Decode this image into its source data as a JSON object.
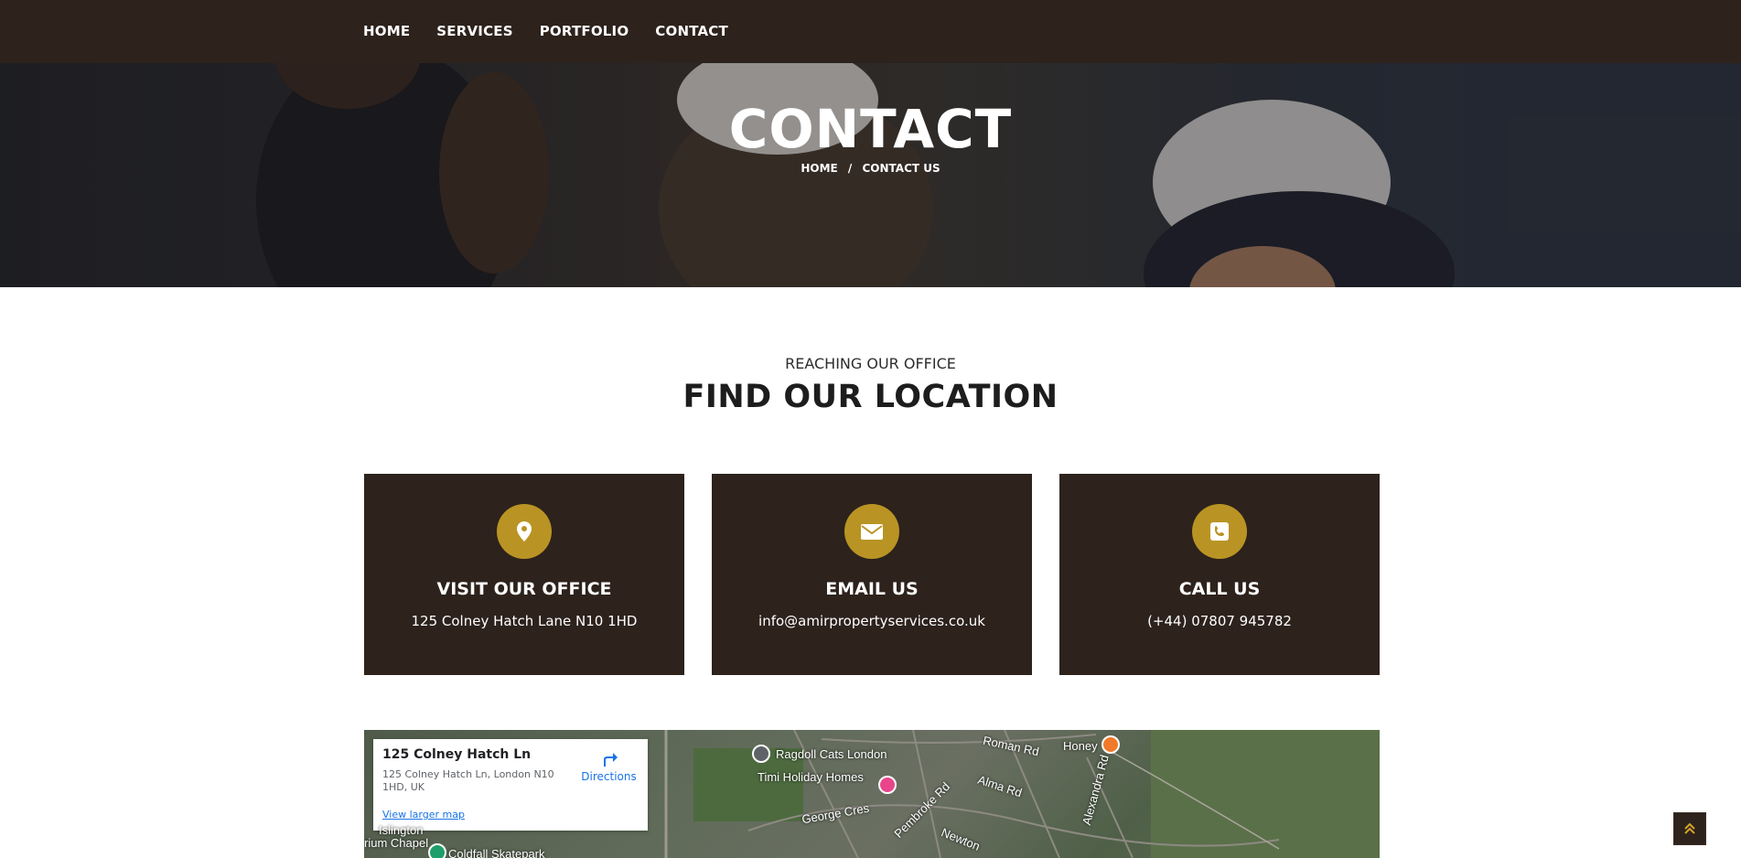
{
  "nav": {
    "items": [
      {
        "label": "HOME"
      },
      {
        "label": "SERVICES"
      },
      {
        "label": "PORTFOLIO"
      },
      {
        "label": "CONTACT"
      }
    ]
  },
  "hero": {
    "title": "CONTACT",
    "breadcrumb": {
      "home": "HOME",
      "separator": "/",
      "current": "CONTACT US"
    }
  },
  "section": {
    "subtitle": "REACHING OUR OFFICE",
    "title": "FIND OUR LOCATION"
  },
  "cards": [
    {
      "icon": "map-marker-icon",
      "title": "VISIT OUR OFFICE",
      "text": "125 Colney Hatch Lane N10 1HD"
    },
    {
      "icon": "envelope-icon",
      "title": "EMAIL US",
      "text": "info@amirpropertyservices.co.uk"
    },
    {
      "icon": "phone-icon",
      "title": "CALL US",
      "text": "(+44) 07807 945782"
    }
  ],
  "map": {
    "place_name": "125 Colney Hatch Ln",
    "address": "125 Colney Hatch Ln, London N10 1HD, UK",
    "directions_label": "Directions",
    "larger_map_label": "View larger map",
    "labels": {
      "ragdoll": "Ragdoll Cats London",
      "timi": "Timi Holiday Homes",
      "roman": "Roman Rd",
      "honey": "Honey",
      "alma": "Alma Rd",
      "george": "George Cres",
      "pembroke": "Pembroke Rd",
      "alexandra": "Alexandra Rd",
      "newton": "Newton",
      "islington": "Islington",
      "chapel": "rium Chapel",
      "skatepark": "Coldfall Skatepark"
    }
  },
  "colors": {
    "dark_brown": "#2d221c",
    "gold": "#b99424",
    "link_blue": "#1a73e8"
  },
  "scroll_top_icon": "double-chevron-up-icon"
}
